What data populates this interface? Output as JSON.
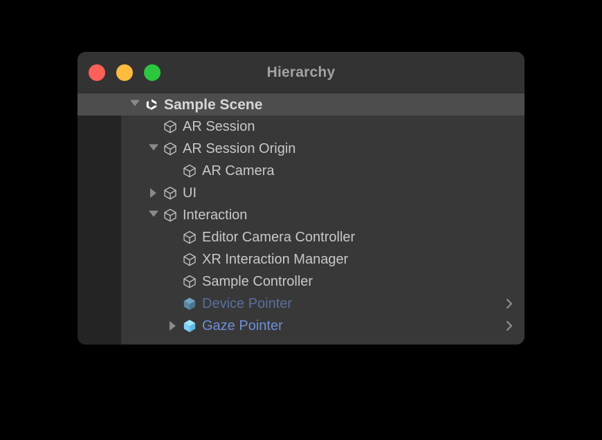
{
  "window": {
    "title": "Hierarchy",
    "controls": [
      {
        "name": "close-button",
        "color": "#fc6058"
      },
      {
        "name": "minimize-button",
        "color": "#fdbc40"
      },
      {
        "name": "maximize-button",
        "color": "#2cc63f"
      }
    ]
  },
  "colors": {
    "window_background": "#383838",
    "titlebar_background": "#333333",
    "gutter": "#242424",
    "selected_row": "#4d4d4d",
    "label": "#c8c8c8",
    "prefab_label": "#6f8fd8",
    "prefab_label_dim": "#5a6f9e",
    "prefab_icon": "#7fd4f5",
    "prefab_icon_dim": "#5a8aa8",
    "twisty": "#8a8a8a"
  },
  "hierarchy": {
    "rows": [
      {
        "label": "Sample Scene",
        "level": 0,
        "icon": "unity-scene-icon",
        "twisty": "open",
        "selected": true,
        "style": "scene",
        "chevron": false
      },
      {
        "label": "AR Session",
        "level": 1,
        "icon": "gameobject-cube-icon",
        "twisty": "none",
        "selected": false,
        "style": "normal",
        "chevron": false
      },
      {
        "label": "AR Session Origin",
        "level": 1,
        "icon": "gameobject-cube-icon",
        "twisty": "open",
        "selected": false,
        "style": "normal",
        "chevron": false
      },
      {
        "label": "AR Camera",
        "level": 2,
        "icon": "gameobject-cube-icon",
        "twisty": "none",
        "selected": false,
        "style": "normal",
        "chevron": false
      },
      {
        "label": "UI",
        "level": 1,
        "icon": "gameobject-cube-icon",
        "twisty": "closed",
        "selected": false,
        "style": "normal",
        "chevron": false
      },
      {
        "label": "Interaction",
        "level": 1,
        "icon": "gameobject-cube-icon",
        "twisty": "open",
        "selected": false,
        "style": "normal",
        "chevron": false
      },
      {
        "label": "Editor Camera Controller",
        "level": 2,
        "icon": "gameobject-cube-icon",
        "twisty": "none",
        "selected": false,
        "style": "normal",
        "chevron": false
      },
      {
        "label": "XR Interaction Manager",
        "level": 2,
        "icon": "gameobject-cube-icon",
        "twisty": "none",
        "selected": false,
        "style": "normal",
        "chevron": false
      },
      {
        "label": "Sample Controller",
        "level": 2,
        "icon": "gameobject-cube-icon",
        "twisty": "none",
        "selected": false,
        "style": "normal",
        "chevron": false
      },
      {
        "label": "Device Pointer",
        "level": 2,
        "icon": "prefab-cube-icon-dim",
        "twisty": "none",
        "selected": false,
        "style": "prefab-dim",
        "chevron": true
      },
      {
        "label": "Gaze Pointer",
        "level": 2,
        "icon": "prefab-cube-icon",
        "twisty": "closed",
        "selected": false,
        "style": "prefab",
        "chevron": true
      }
    ]
  }
}
